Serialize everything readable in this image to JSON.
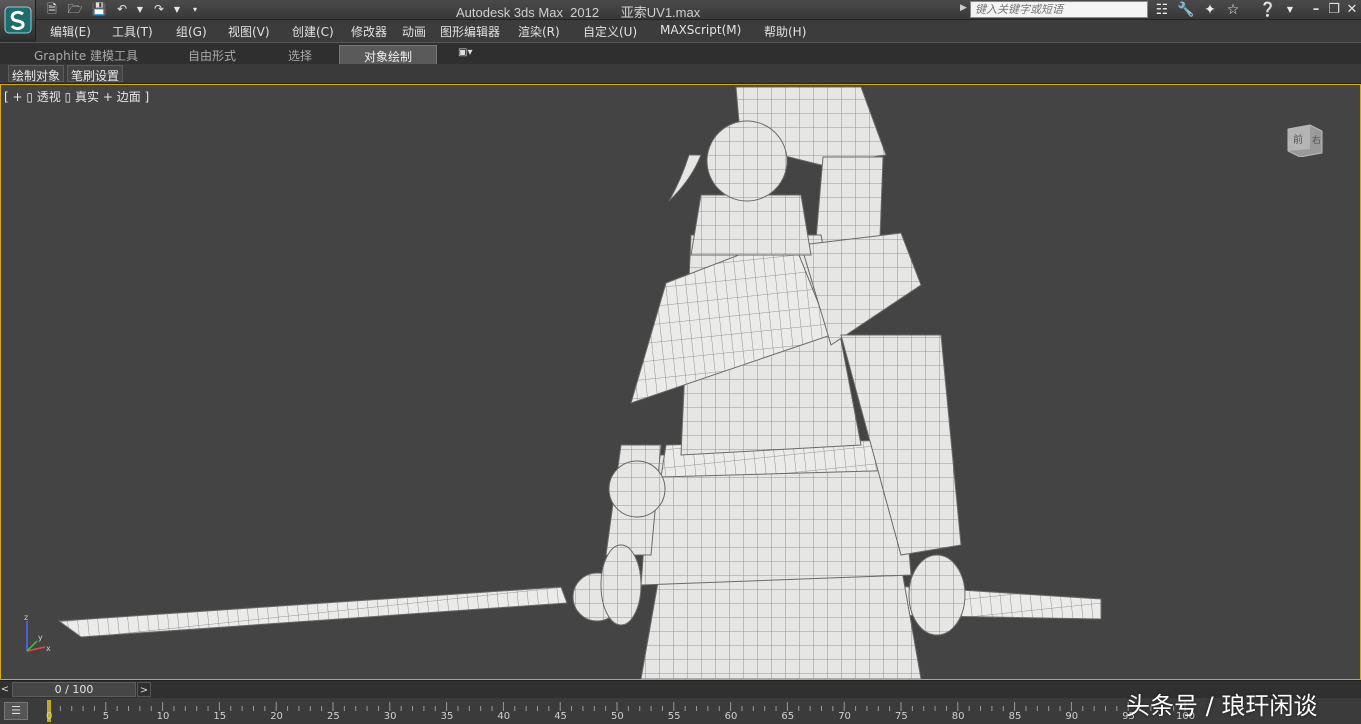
{
  "window": {
    "title": "Autodesk 3ds Max  2012      亚索UV1.max"
  },
  "quick_access": {
    "icons": [
      "new-file-icon",
      "open-folder-icon",
      "save-icon",
      "undo-icon",
      "dropdown-arrow-icon",
      "redo-icon",
      "dropdown-arrow-icon",
      "customize-dropdown-icon"
    ]
  },
  "search": {
    "placeholder": "键入关键字或短语"
  },
  "toolbar_right": {
    "icons": [
      "binoculars-icon",
      "wrench-icon",
      "satellite-icon",
      "star-icon",
      "help-icon"
    ]
  },
  "menu": {
    "items": [
      "编辑(E)",
      "工具(T)",
      "组(G)",
      "视图(V)",
      "创建(C)",
      "修改器",
      "动画",
      "图形编辑器",
      "渲染(R)",
      "自定义(U)",
      "MAXScript(M)",
      "帮助(H)"
    ]
  },
  "ribbon": {
    "tabs": [
      "Graphite 建模工具",
      "自由形式",
      "选择",
      "对象绘制"
    ],
    "active_tab_index": 3,
    "panel_buttons": [
      "绘制对象",
      "笔刷设置"
    ]
  },
  "viewport": {
    "label": "[ + ▯ 透视 ▯ 真实 + 边面 ]",
    "viewcube_labels": [
      "前",
      "右"
    ],
    "axis_labels": [
      "z",
      "x",
      "y"
    ],
    "border_color": "#d6a81e",
    "background_color": "#444444"
  },
  "timeline": {
    "current": "0 / 100",
    "ticks": [
      "0",
      "5",
      "10",
      "15",
      "20",
      "25",
      "30",
      "35",
      "40",
      "45",
      "50",
      "55",
      "60",
      "65",
      "70",
      "75",
      "80",
      "85",
      "90",
      "95",
      "100"
    ]
  },
  "watermark": {
    "text": "头条号 / 琅玕闲谈"
  }
}
